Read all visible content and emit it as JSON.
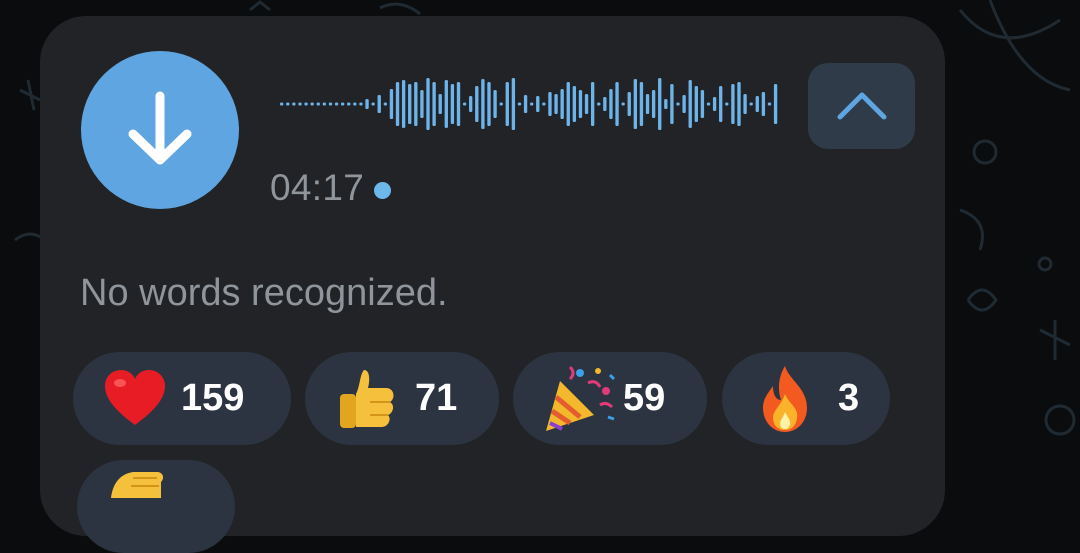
{
  "voice_message": {
    "duration": "04:17",
    "transcript": "No words recognized."
  },
  "reactions": [
    {
      "emoji": "heart",
      "count": "159"
    },
    {
      "emoji": "thumbs-up",
      "count": "71"
    },
    {
      "emoji": "party-popper",
      "count": "59"
    },
    {
      "emoji": "fire",
      "count": "3"
    },
    {
      "emoji": "clapping-hands",
      "count": ""
    }
  ],
  "colors": {
    "bubble": "#212326",
    "accent": "#5fa5e1",
    "reaction_bg": "#2b3440",
    "muted_text": "#8f959b"
  }
}
